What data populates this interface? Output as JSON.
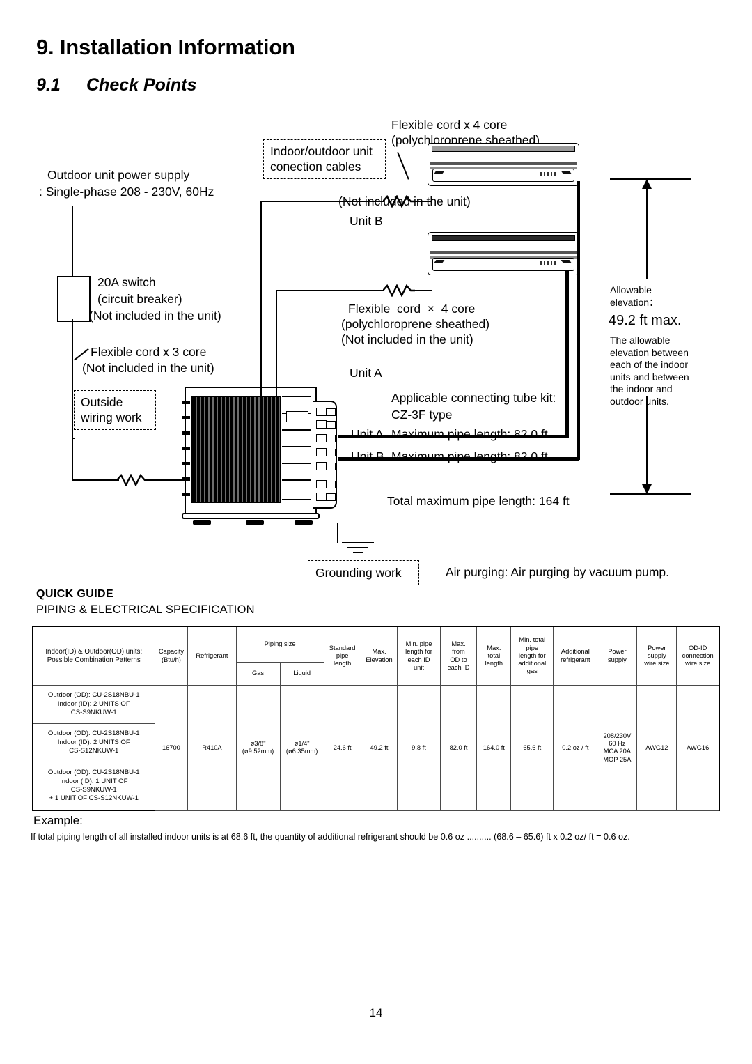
{
  "document": {
    "chapter_title": "9. Installation Information",
    "section_number": "9.1",
    "section_title": "Check Points",
    "page_number": "14"
  },
  "diagram": {
    "power_supply_line1": "Outdoor unit power supply",
    "power_supply_line2": ": Single-phase 208 - 230V, 60Hz",
    "breaker_line1": "20A switch",
    "breaker_line2": "(circuit breaker)",
    "breaker_line3": "(Not included in the unit)",
    "cord3_line1": "Flexible cord x 3 core",
    "cord3_line2": "(Not included in the unit)",
    "outside_wiring": "Outside\nwiring work",
    "connection_cables": "Indoor/outdoor unit\nconection cables",
    "cord4_top_line1": "Flexible cord x 4 core",
    "cord4_top_line2": "(polychloroprene sheathed)",
    "cord4_top_line3": "(Not included in the unit)",
    "unit_b_label": "Unit B",
    "cord4_bottom_line1": "Flexible  cord  ×  4 core",
    "cord4_bottom_line2": "(polychloroprene sheathed)",
    "cord4_bottom_line3": "(Not included in the unit)",
    "unit_a_label": "Unit A",
    "tube_kit_line1": "Applicable connecting tube kit:",
    "tube_kit_line2": "CZ-3F type",
    "unit_a_pipe_label": "Unit A",
    "unit_a_pipe_text": "Maximum pipe length: 82.0 ft",
    "unit_b_pipe_label": "Unit B",
    "unit_b_pipe_text": "Maximum pipe length: 82.0 ft",
    "total_pipe": "Total maximum pipe length: 164 ft",
    "grounding_work": "Grounding work",
    "air_purging": "Air purging: Air purging by vacuum pump.",
    "elevation_title": "Allowable\nelevation：",
    "elevation_value": "49.2 ft max.",
    "elevation_note": "The allowable\nelevation between\neach of the indoor\nunits and between\nthe indoor and\noutdoor units."
  },
  "quick_guide": {
    "title": "QUICK GUIDE",
    "subtitle": "PIPING & ELECTRICAL SPECIFICATION"
  },
  "table": {
    "headers": {
      "combination": "Indoor(ID) & Outdoor(OD) units:\nPossible Combination Patterns",
      "capacity": "Capacity\n(Btu/h)",
      "refrigerant": "Refrigerant",
      "piping_size": "Piping size",
      "gas": "Gas",
      "liquid": "Liquid",
      "standard_pipe_length": "Standard\npipe\nlength",
      "max_elevation": "Max.\nElevation",
      "min_pipe_each_id": "Min. pipe\nlength for\neach ID\nunit",
      "max_od_to_id": "Max.\nfrom\nOD to\neach ID",
      "max_total_length": "Max.\ntotal\nlength",
      "min_total_additional_gas": "Min. total\npipe\nlength for\nadditional\ngas",
      "additional_refrigerant": "Additional\nrefrigerant",
      "power_supply": "Power\nsupply",
      "power_supply_wire_size": "Power\nsupply\nwire size",
      "od_id_connection_wire_size": "OD-ID\nconnection\nwire size"
    },
    "patterns": [
      "Outdoor (OD): CU-2S18NBU-1\nIndoor (ID): 2 UNITS OF\nCS-S9NKUW-1",
      "Outdoor (OD): CU-2S18NBU-1\nIndoor (ID): 2 UNITS OF\nCS-S12NKUW-1",
      "Outdoor (OD): CU-2S18NBU-1\nIndoor (ID): 1 UNIT OF\nCS-S9NKUW-1\n+ 1 UNIT OF CS-S12NKUW-1"
    ],
    "values": {
      "capacity": "16700",
      "refrigerant": "R410A",
      "gas": "ø3/8\"\n(ø9.52mm)",
      "liquid": "ø1/4\"\n(ø6.35mm)",
      "standard_pipe_length": "24.6 ft",
      "max_elevation": "49.2 ft",
      "min_pipe_each_id": "9.8 ft",
      "max_od_to_id": "82.0 ft",
      "max_total_length": "164.0 ft",
      "min_total_additional_gas": "65.6 ft",
      "additional_refrigerant": "0.2 oz / ft",
      "power_supply": "208/230V\n60 Hz\nMCA 20A\nMOP 25A",
      "power_supply_wire_size": "AWG12",
      "od_id_connection_wire_size": "AWG16"
    }
  },
  "example": {
    "title": "Example:",
    "body": "If total piping length of all installed indoor units is at 68.6 ft, the quantity of additional refrigerant should be 0.6 oz .......... (68.6 – 65.6) ft x 0.2 oz/ ft = 0.6 oz."
  }
}
